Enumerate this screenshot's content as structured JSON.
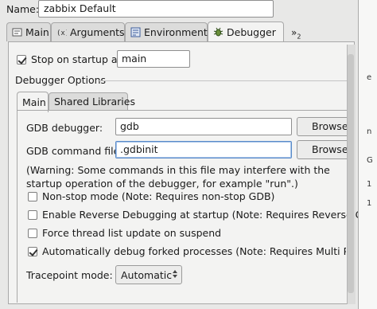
{
  "name": {
    "label": "Name:",
    "value": "zabbix Default"
  },
  "tabs": [
    {
      "label": "Main",
      "icon": "main-icon",
      "active": false
    },
    {
      "label": "Arguments",
      "icon": "arguments-icon",
      "active": false
    },
    {
      "label": "Environment",
      "icon": "environment-icon",
      "active": false
    },
    {
      "label": "Debugger",
      "icon": "debugger-icon",
      "active": true
    }
  ],
  "tabs_overflow": {
    "label": "»",
    "count": "2"
  },
  "stop_on_startup": {
    "label": "Stop on startup at:",
    "checked": true,
    "value": "main"
  },
  "debugger_options": {
    "title": "Debugger Options",
    "subtabs": [
      {
        "label": "Main",
        "active": true
      },
      {
        "label": "Shared Libraries",
        "active": false
      }
    ],
    "gdb_debugger": {
      "label": "GDB debugger:",
      "value": "gdb",
      "browse": "Browse..."
    },
    "gdb_command_file": {
      "label": "GDB command file:",
      "value": ".gdbinit",
      "browse": "Browse..."
    },
    "warning": "(Warning: Some commands in this file may interfere with the startup operation of the debugger, for example \"run\".)",
    "checkboxes": [
      {
        "label": "Non-stop mode (Note: Requires non-stop GDB)",
        "checked": false
      },
      {
        "label": "Enable Reverse Debugging at startup (Note: Requires Reverse GDB)",
        "checked": false
      },
      {
        "label": "Force thread list update on suspend",
        "checked": false
      },
      {
        "label": "Automatically debug forked processes (Note: Requires Multi Process GDB)",
        "checked": true
      }
    ],
    "tracepoint_mode": {
      "label": "Tracepoint mode:",
      "value": "Automatic"
    }
  },
  "background_window": {
    "fragments": [
      "e",
      "n",
      "G",
      "1",
      "1"
    ]
  },
  "colors": {
    "panel_bg": "#f3f3f2",
    "window_bg": "#e8e8e7",
    "focus_border": "#5a8bc9"
  }
}
